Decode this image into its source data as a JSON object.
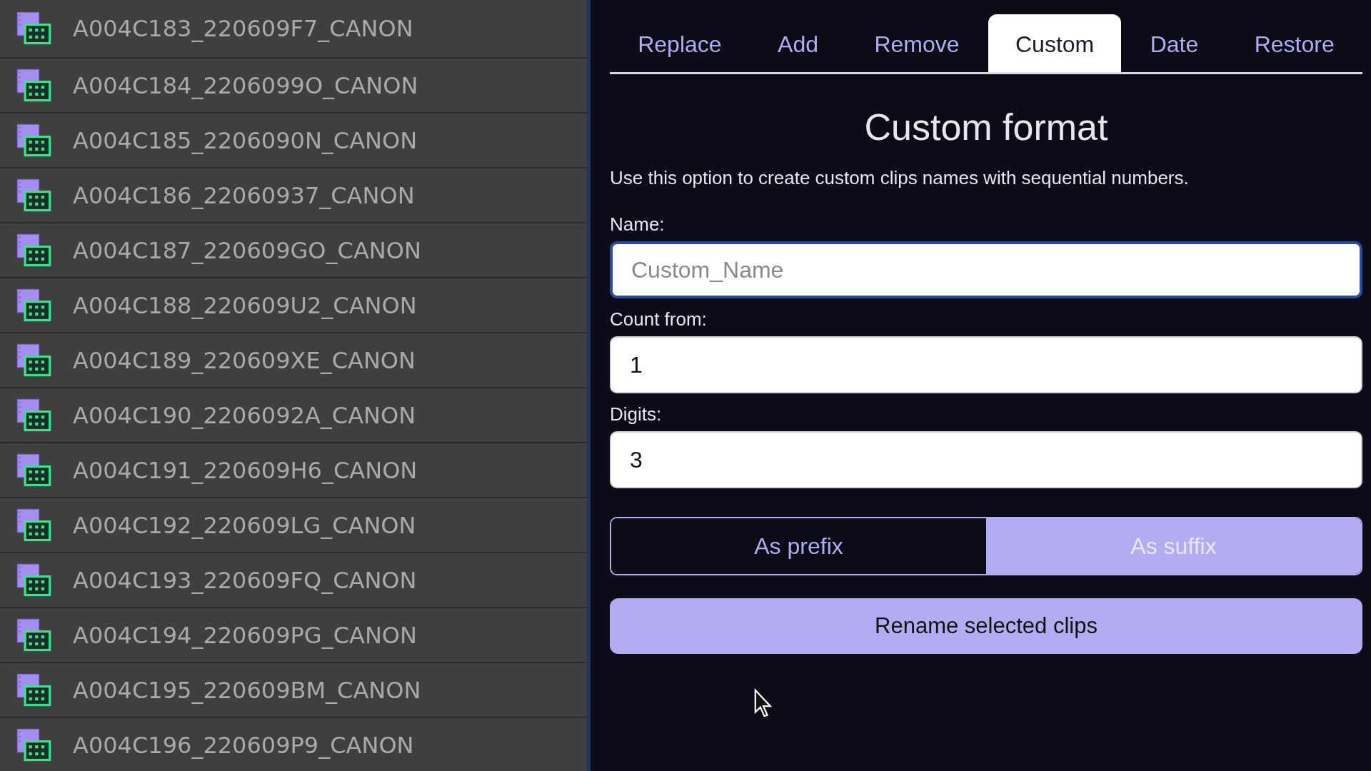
{
  "clips": [
    {
      "name": "A004C183_220609F7_CANON"
    },
    {
      "name": "A004C184_2206099O_CANON"
    },
    {
      "name": "A004C185_2206090N_CANON"
    },
    {
      "name": "A004C186_22060937_CANON"
    },
    {
      "name": "A004C187_220609GO_CANON"
    },
    {
      "name": "A004C188_220609U2_CANON"
    },
    {
      "name": "A004C189_220609XE_CANON"
    },
    {
      "name": "A004C190_2206092A_CANON"
    },
    {
      "name": "A004C191_220609H6_CANON"
    },
    {
      "name": "A004C192_220609LG_CANON"
    },
    {
      "name": "A004C193_220609FQ_CANON"
    },
    {
      "name": "A004C194_220609PG_CANON"
    },
    {
      "name": "A004C195_220609BM_CANON"
    },
    {
      "name": "A004C196_220609P9_CANON"
    }
  ],
  "tabs": [
    {
      "label": "Replace",
      "selected": false
    },
    {
      "label": "Add",
      "selected": false
    },
    {
      "label": "Remove",
      "selected": false
    },
    {
      "label": "Custom",
      "selected": true
    },
    {
      "label": "Date",
      "selected": false
    },
    {
      "label": "Restore",
      "selected": false
    }
  ],
  "title": "Custom format",
  "description": "Use this option to create custom clips names with sequential numbers.",
  "fields": [
    {
      "label": "Name:",
      "placeholder": "Custom_Name",
      "focused": true
    },
    {
      "label": "Count from:",
      "value": "1",
      "focused": false
    },
    {
      "label": "Digits:",
      "value": "3",
      "focused": false
    }
  ],
  "position_options": [
    {
      "label": "As prefix",
      "selected": false
    },
    {
      "label": "As suffix",
      "selected": true
    }
  ],
  "rename_button": "Rename selected clips"
}
